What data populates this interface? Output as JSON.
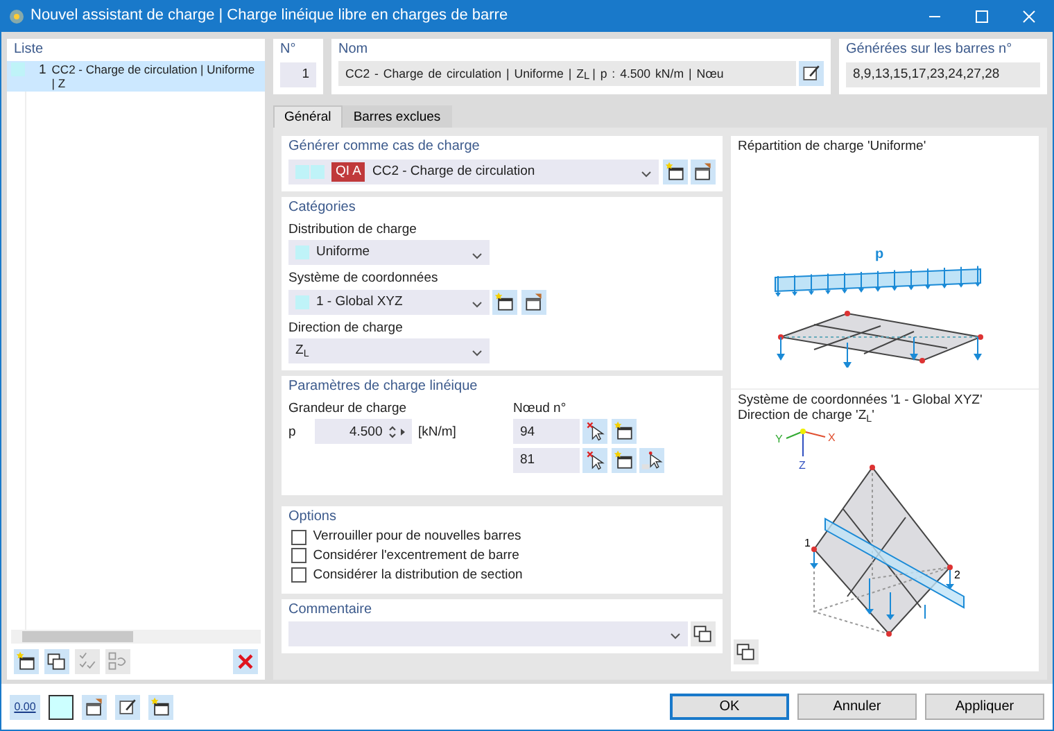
{
  "window": {
    "title": "Nouvel assistant de charge | Charge linéique libre en charges de barre"
  },
  "list": {
    "title": "Liste",
    "items": [
      {
        "number": "1",
        "label": "CC2 - Charge de circulation | Uniforme | Z",
        "selected": true
      }
    ]
  },
  "number": {
    "label": "N°",
    "value": "1"
  },
  "name": {
    "label": "Nom",
    "value": "CC2 - Charge de circulation | Uniforme | Z$_{L}$ | p : 4.500 kN/m | Nœu"
  },
  "generated": {
    "label": "Générées sur les barres n°",
    "value": "8,9,13,15,17,23,24,27,28"
  },
  "tabs": [
    {
      "label": "Général",
      "selected": true
    },
    {
      "label": "Barres exclues",
      "selected": false
    }
  ],
  "load_case": {
    "title": "Générer comme cas de charge",
    "badge": "QI A",
    "value": "CC2 - Charge de circulation"
  },
  "categories": {
    "title": "Catégories",
    "fields": [
      {
        "label": "Distribution de charge",
        "value": "Uniforme",
        "swatch": true,
        "tools": false
      },
      {
        "label": "Système de coordonnées",
        "value": "1 - Global XYZ",
        "swatch": true,
        "tools": true
      },
      {
        "label": "Direction de charge",
        "value": "Z$_{L}$",
        "swatch": false,
        "tools": false
      }
    ]
  },
  "line_load": {
    "title": "Paramètres de charge linéique",
    "magnitude": {
      "label": "Grandeur de charge",
      "symbol": "p",
      "value": "4.500",
      "unit": "[kN/m]"
    },
    "nodes": {
      "label": "Nœud n°",
      "items": [
        {
          "value": "94",
          "extra_tool": false
        },
        {
          "value": "81",
          "extra_tool": true
        }
      ]
    }
  },
  "options": {
    "title": "Options",
    "items": [
      {
        "label": "Verrouiller pour de nouvelles barres",
        "checked": false
      },
      {
        "label": "Considérer l'excentrement de barre",
        "checked": false
      },
      {
        "label": "Considérer la distribution de section",
        "checked": false
      }
    ]
  },
  "comment": {
    "title": "Commentaire"
  },
  "preview": {
    "distribution_title": "Répartition de charge 'Uniforme'",
    "load_symbol": "p",
    "system_title": "Système de coordonnées '1 - Global XYZ'",
    "direction_title": "Direction de charge 'Z$_{L}$'",
    "axes": [
      "X",
      "Y",
      "Z"
    ],
    "node_labels": [
      "1",
      "2"
    ]
  },
  "footer": {
    "value_icon": "0.00",
    "buttons": [
      {
        "label": "OK",
        "default": true
      },
      {
        "label": "Annuler",
        "default": false
      },
      {
        "label": "Appliquer",
        "default": false
      }
    ]
  }
}
